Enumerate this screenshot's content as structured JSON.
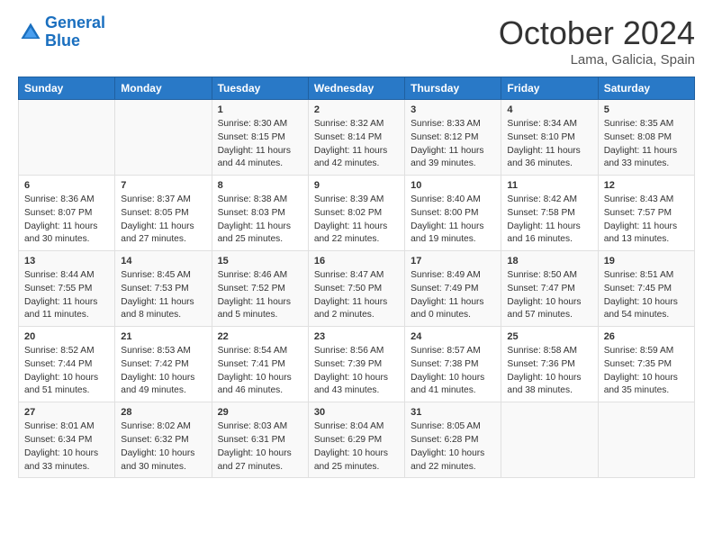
{
  "header": {
    "logo_line1": "General",
    "logo_line2": "Blue",
    "month": "October 2024",
    "location": "Lama, Galicia, Spain"
  },
  "weekdays": [
    "Sunday",
    "Monday",
    "Tuesday",
    "Wednesday",
    "Thursday",
    "Friday",
    "Saturday"
  ],
  "rows": [
    [
      {
        "day": "",
        "content": ""
      },
      {
        "day": "",
        "content": ""
      },
      {
        "day": "1",
        "content": "Sunrise: 8:30 AM\nSunset: 8:15 PM\nDaylight: 11 hours\nand 44 minutes."
      },
      {
        "day": "2",
        "content": "Sunrise: 8:32 AM\nSunset: 8:14 PM\nDaylight: 11 hours\nand 42 minutes."
      },
      {
        "day": "3",
        "content": "Sunrise: 8:33 AM\nSunset: 8:12 PM\nDaylight: 11 hours\nand 39 minutes."
      },
      {
        "day": "4",
        "content": "Sunrise: 8:34 AM\nSunset: 8:10 PM\nDaylight: 11 hours\nand 36 minutes."
      },
      {
        "day": "5",
        "content": "Sunrise: 8:35 AM\nSunset: 8:08 PM\nDaylight: 11 hours\nand 33 minutes."
      }
    ],
    [
      {
        "day": "6",
        "content": "Sunrise: 8:36 AM\nSunset: 8:07 PM\nDaylight: 11 hours\nand 30 minutes."
      },
      {
        "day": "7",
        "content": "Sunrise: 8:37 AM\nSunset: 8:05 PM\nDaylight: 11 hours\nand 27 minutes."
      },
      {
        "day": "8",
        "content": "Sunrise: 8:38 AM\nSunset: 8:03 PM\nDaylight: 11 hours\nand 25 minutes."
      },
      {
        "day": "9",
        "content": "Sunrise: 8:39 AM\nSunset: 8:02 PM\nDaylight: 11 hours\nand 22 minutes."
      },
      {
        "day": "10",
        "content": "Sunrise: 8:40 AM\nSunset: 8:00 PM\nDaylight: 11 hours\nand 19 minutes."
      },
      {
        "day": "11",
        "content": "Sunrise: 8:42 AM\nSunset: 7:58 PM\nDaylight: 11 hours\nand 16 minutes."
      },
      {
        "day": "12",
        "content": "Sunrise: 8:43 AM\nSunset: 7:57 PM\nDaylight: 11 hours\nand 13 minutes."
      }
    ],
    [
      {
        "day": "13",
        "content": "Sunrise: 8:44 AM\nSunset: 7:55 PM\nDaylight: 11 hours\nand 11 minutes."
      },
      {
        "day": "14",
        "content": "Sunrise: 8:45 AM\nSunset: 7:53 PM\nDaylight: 11 hours\nand 8 minutes."
      },
      {
        "day": "15",
        "content": "Sunrise: 8:46 AM\nSunset: 7:52 PM\nDaylight: 11 hours\nand 5 minutes."
      },
      {
        "day": "16",
        "content": "Sunrise: 8:47 AM\nSunset: 7:50 PM\nDaylight: 11 hours\nand 2 minutes."
      },
      {
        "day": "17",
        "content": "Sunrise: 8:49 AM\nSunset: 7:49 PM\nDaylight: 11 hours\nand 0 minutes."
      },
      {
        "day": "18",
        "content": "Sunrise: 8:50 AM\nSunset: 7:47 PM\nDaylight: 10 hours\nand 57 minutes."
      },
      {
        "day": "19",
        "content": "Sunrise: 8:51 AM\nSunset: 7:45 PM\nDaylight: 10 hours\nand 54 minutes."
      }
    ],
    [
      {
        "day": "20",
        "content": "Sunrise: 8:52 AM\nSunset: 7:44 PM\nDaylight: 10 hours\nand 51 minutes."
      },
      {
        "day": "21",
        "content": "Sunrise: 8:53 AM\nSunset: 7:42 PM\nDaylight: 10 hours\nand 49 minutes."
      },
      {
        "day": "22",
        "content": "Sunrise: 8:54 AM\nSunset: 7:41 PM\nDaylight: 10 hours\nand 46 minutes."
      },
      {
        "day": "23",
        "content": "Sunrise: 8:56 AM\nSunset: 7:39 PM\nDaylight: 10 hours\nand 43 minutes."
      },
      {
        "day": "24",
        "content": "Sunrise: 8:57 AM\nSunset: 7:38 PM\nDaylight: 10 hours\nand 41 minutes."
      },
      {
        "day": "25",
        "content": "Sunrise: 8:58 AM\nSunset: 7:36 PM\nDaylight: 10 hours\nand 38 minutes."
      },
      {
        "day": "26",
        "content": "Sunrise: 8:59 AM\nSunset: 7:35 PM\nDaylight: 10 hours\nand 35 minutes."
      }
    ],
    [
      {
        "day": "27",
        "content": "Sunrise: 8:01 AM\nSunset: 6:34 PM\nDaylight: 10 hours\nand 33 minutes."
      },
      {
        "day": "28",
        "content": "Sunrise: 8:02 AM\nSunset: 6:32 PM\nDaylight: 10 hours\nand 30 minutes."
      },
      {
        "day": "29",
        "content": "Sunrise: 8:03 AM\nSunset: 6:31 PM\nDaylight: 10 hours\nand 27 minutes."
      },
      {
        "day": "30",
        "content": "Sunrise: 8:04 AM\nSunset: 6:29 PM\nDaylight: 10 hours\nand 25 minutes."
      },
      {
        "day": "31",
        "content": "Sunrise: 8:05 AM\nSunset: 6:28 PM\nDaylight: 10 hours\nand 22 minutes."
      },
      {
        "day": "",
        "content": ""
      },
      {
        "day": "",
        "content": ""
      }
    ]
  ]
}
